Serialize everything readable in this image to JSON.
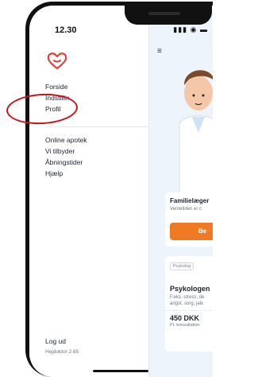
{
  "status": {
    "time": "12.30"
  },
  "drawer": {
    "menu": [
      "Forside",
      "Indstillin",
      "Profil"
    ],
    "menu2": [
      "Online apotek",
      "Vi tilbyder",
      "Åbningstider",
      "Hjælp"
    ],
    "logout": "Log ud",
    "version": "Hejdoktor 2.65"
  },
  "app": {
    "card1": {
      "title": "Familielæger",
      "subtitle": "Ventetiden er c",
      "button": "Be"
    },
    "card2": {
      "tag": "Psykolog",
      "title": "Psykologen",
      "desc1": "F.eks. stress, de",
      "desc2": "angst, sorg, jalo",
      "price": "450 DKK",
      "unit": "Pr. konsultation"
    }
  },
  "colors": {
    "accent": "#f07a24",
    "annotation": "#c7141c",
    "brand": "#e0423a"
  },
  "icons": {
    "logo": "heart-logo-icon",
    "menu": "hamburger-icon"
  }
}
